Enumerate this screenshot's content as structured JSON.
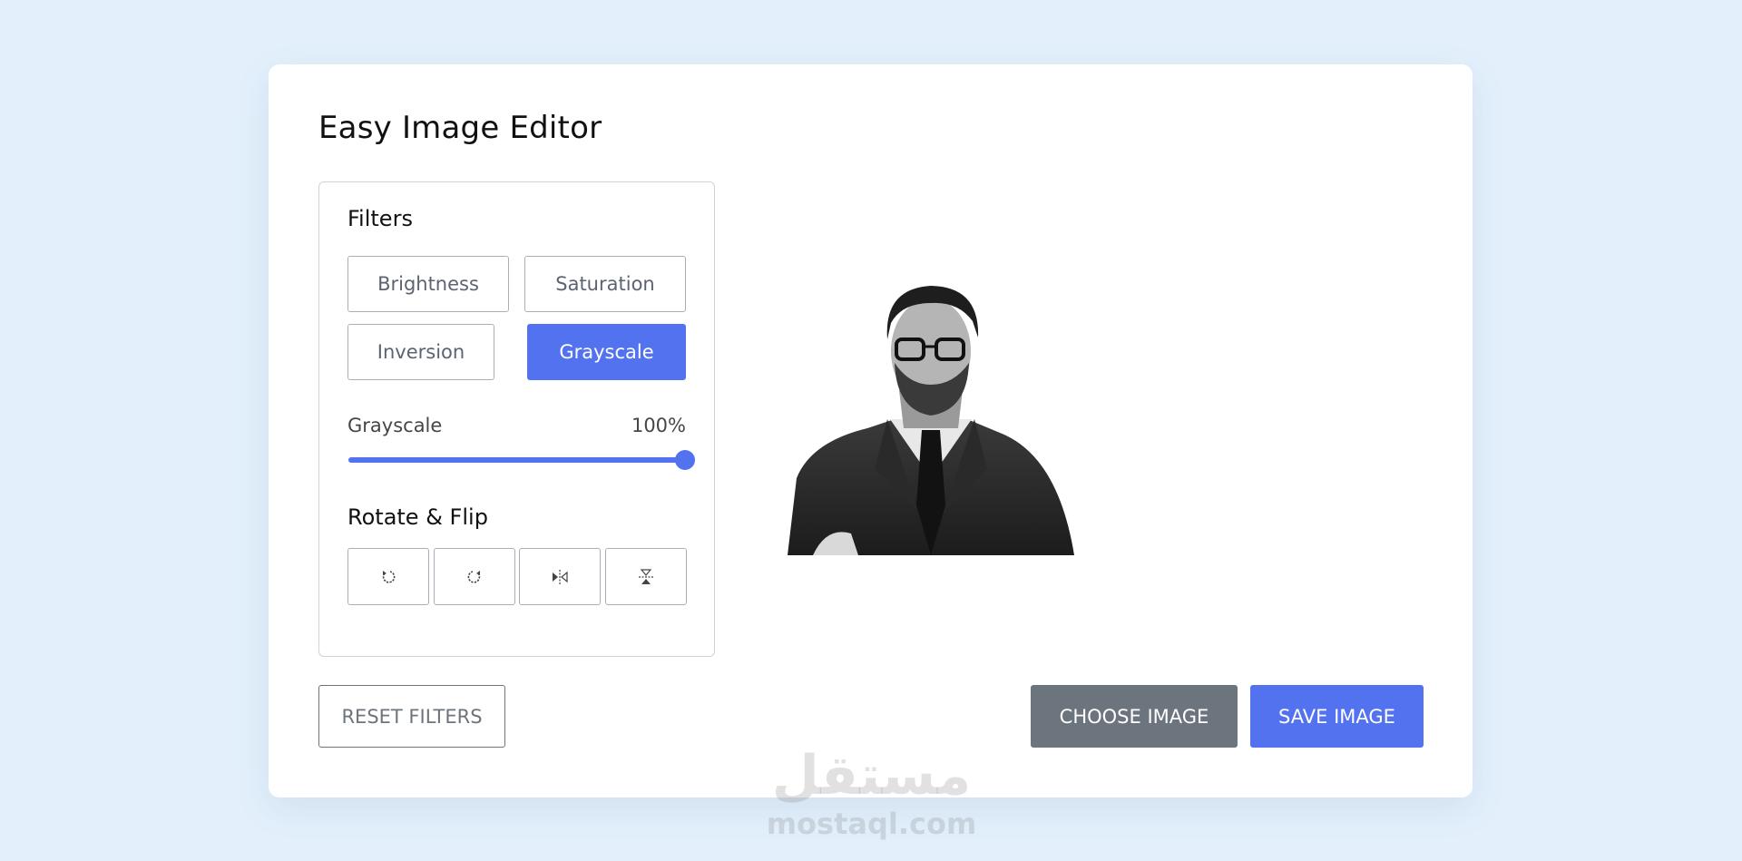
{
  "app": {
    "title": "Easy Image Editor"
  },
  "filters": {
    "heading": "Filters",
    "buttons": [
      {
        "label": "Brightness",
        "active": false
      },
      {
        "label": "Saturation",
        "active": false
      },
      {
        "label": "Inversion",
        "active": false
      },
      {
        "label": "Grayscale",
        "active": true
      }
    ],
    "slider": {
      "name": "Grayscale",
      "value_text": "100%",
      "value": 100
    }
  },
  "rotate": {
    "heading": "Rotate & Flip",
    "buttons": [
      {
        "icon": "rotate-left-icon"
      },
      {
        "icon": "rotate-right-icon"
      },
      {
        "icon": "flip-horizontal-icon"
      },
      {
        "icon": "flip-vertical-icon"
      }
    ]
  },
  "actions": {
    "reset": "RESET FILTERS",
    "choose": "CHOOSE IMAGE",
    "save": "SAVE IMAGE"
  },
  "preview": {
    "description": "grayscale portrait photo"
  },
  "watermark": {
    "arabic": "مستقل",
    "text": "mostaql.com"
  },
  "colors": {
    "accent": "#5372f0",
    "secondary": "#6c757d",
    "background": "#e3f0fc"
  }
}
